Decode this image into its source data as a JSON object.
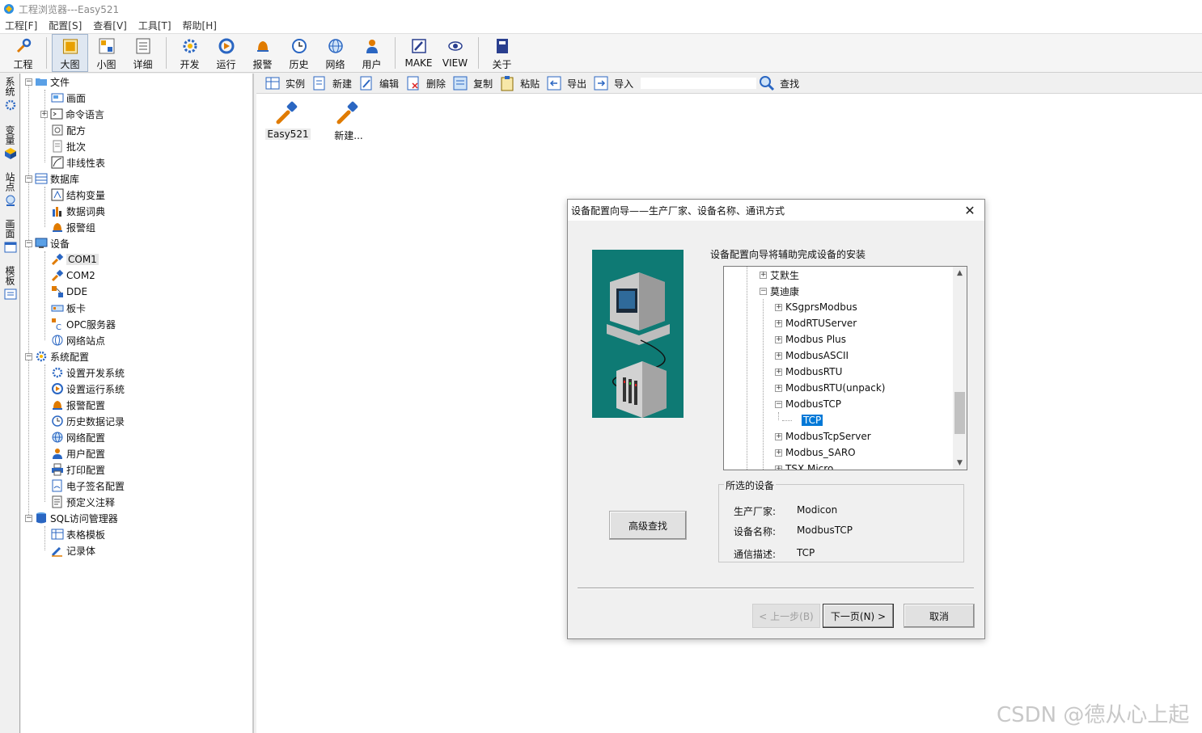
{
  "window": {
    "title": "工程浏览器---Easy521"
  },
  "menu": [
    "工程[F]",
    "配置[S]",
    "查看[V]",
    "工具[T]",
    "帮助[H]"
  ],
  "toolbar": {
    "group1": [
      {
        "label": "工程",
        "icon": "wrench-icon"
      }
    ],
    "group2": [
      {
        "label": "大图",
        "icon": "large-icons-icon",
        "selected": true
      },
      {
        "label": "小图",
        "icon": "small-icons-icon"
      },
      {
        "label": "详细",
        "icon": "details-icon"
      }
    ],
    "group3": [
      {
        "label": "开发",
        "icon": "develop-gear-icon"
      },
      {
        "label": "运行",
        "icon": "run-icon"
      },
      {
        "label": "报警",
        "icon": "alarm-bell-icon"
      },
      {
        "label": "历史",
        "icon": "history-clock-icon"
      },
      {
        "label": "网络",
        "icon": "network-globe-icon"
      },
      {
        "label": "用户",
        "icon": "user-icon"
      }
    ],
    "group4": [
      {
        "label": "MAKE",
        "icon": "make-pen-icon"
      },
      {
        "label": "VIEW",
        "icon": "view-eye-icon"
      }
    ],
    "group5": [
      {
        "label": "关于",
        "icon": "about-book-icon"
      }
    ]
  },
  "side_tabs": [
    {
      "label": "系统"
    },
    {
      "label": "变量"
    },
    {
      "label": "站点"
    },
    {
      "label": "画面"
    },
    {
      "label": "模板"
    }
  ],
  "tree": {
    "file": {
      "label": "文件",
      "children": [
        "画面",
        "命令语言",
        "配方",
        "批次",
        "非线性表"
      ]
    },
    "database": {
      "label": "数据库",
      "children": [
        "结构变量",
        "数据词典",
        "报警组"
      ]
    },
    "device": {
      "label": "设备",
      "children": [
        "COM1",
        "COM2",
        "DDE",
        "板卡",
        "OPC服务器",
        "网络站点"
      ]
    },
    "sysconfig": {
      "label": "系统配置",
      "children": [
        "设置开发系统",
        "设置运行系统",
        "报警配置",
        "历史数据记录",
        "网络配置",
        "用户配置",
        "打印配置",
        "电子签名配置",
        "预定义注释"
      ]
    },
    "sql": {
      "label": "SQL访问管理器",
      "children": [
        "表格模板",
        "记录体"
      ]
    }
  },
  "subtoolbar": {
    "buttons": [
      "实例",
      "新建",
      "编辑",
      "删除",
      "复制",
      "粘贴",
      "导出",
      "导入"
    ],
    "search_value": "",
    "search_label": "查找"
  },
  "items": [
    {
      "label": "Easy521"
    },
    {
      "label": "新建..."
    }
  ],
  "dialog": {
    "title": "设备配置向导——生产厂家、设备名称、通讯方式",
    "intro": "设备配置向导将辅助完成设备的安装",
    "driver_tree": [
      "艾默生",
      "莫迪康",
      "KSgprsModbus",
      "ModRTUServer",
      "Modbus Plus",
      "ModbusASCII",
      "ModbusRTU",
      "ModbusRTU(unpack)",
      "ModbusTCP",
      "TCP",
      "ModbusTcpServer",
      "Modbus_SARO",
      "TSX Micro"
    ],
    "selected_group": {
      "legend": "所选的设备",
      "manufacturer_label": "生产厂家:",
      "manufacturer": "Modicon",
      "device_label": "设备名称:",
      "device": "ModbusTCP",
      "comm_label": "通信描述:",
      "comm": "TCP"
    },
    "advanced_search": "高级查找",
    "back": "< 上一步(B)",
    "next": "下一页(N) >",
    "cancel": "取消"
  },
  "watermark": "CSDN @德从心上起"
}
